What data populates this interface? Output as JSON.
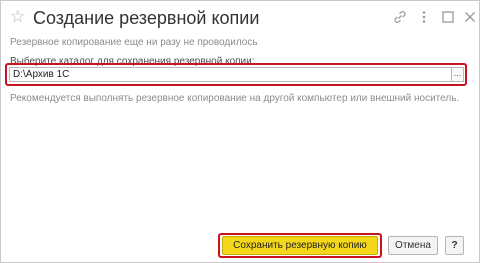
{
  "window": {
    "title": "Создание резервной копии"
  },
  "icons": {
    "favorite": "star-icon",
    "link": "link-icon",
    "more": "more-vertical-icon",
    "maximize": "maximize-icon",
    "close": "close-icon"
  },
  "content": {
    "status_hint": "Резервное копирование еще ни разу не проводилось",
    "directory_label": "Выберите каталог для сохранения резервной копии:",
    "directory_value": "D:\\Архив 1С",
    "select_button_label": "...",
    "recommendation": "Рекомендуется выполнять резервное копирование на другой компьютер или внешний носитель."
  },
  "footer": {
    "save_label": "Сохранить резервную копию",
    "cancel_label": "Отмена",
    "help_label": "?"
  },
  "colors": {
    "accent_button": "#f5d71a",
    "highlight_border": "#c8141e"
  }
}
